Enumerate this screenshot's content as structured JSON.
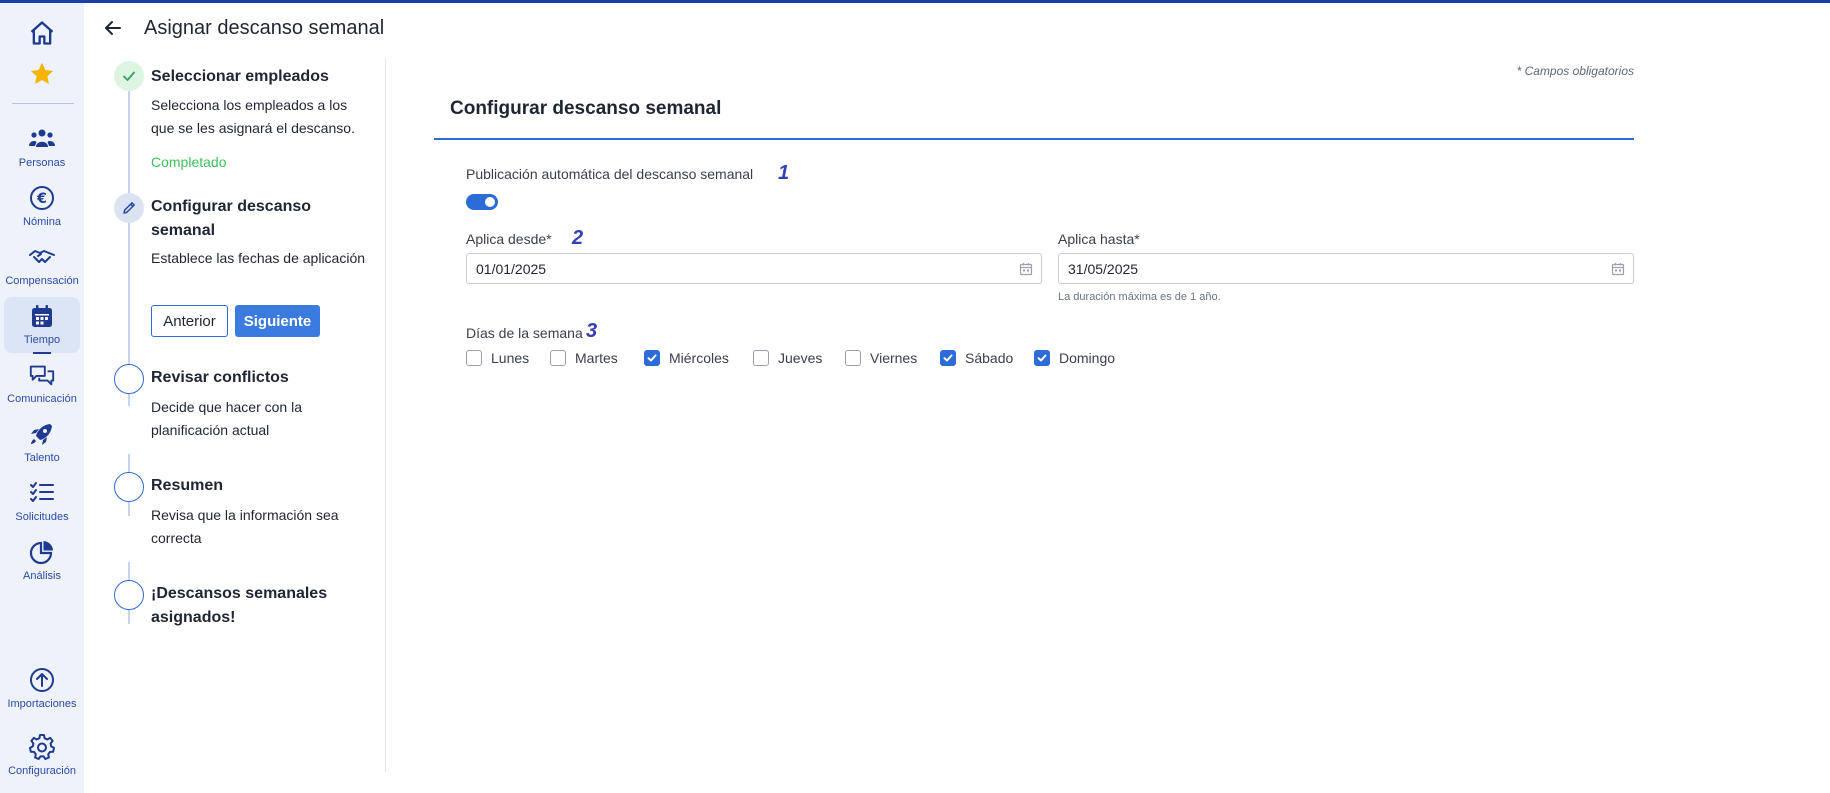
{
  "header": {
    "title": "Asignar descanso semanal"
  },
  "sidebar": {
    "top_icons": [
      {
        "name": "home-icon"
      },
      {
        "name": "star-icon"
      }
    ],
    "items": [
      {
        "label": "Personas",
        "icon": "people-icon"
      },
      {
        "label": "Nómina",
        "icon": "euro-icon"
      },
      {
        "label": "Compensación",
        "icon": "handshake-icon"
      },
      {
        "label": "Tiempo",
        "icon": "calendar-icon",
        "active": true
      },
      {
        "label": "Comunicación",
        "icon": "chat-bubbles-icon"
      },
      {
        "label": "Talento",
        "icon": "rocket-icon"
      },
      {
        "label": "Solicitudes",
        "icon": "checklist-icon"
      },
      {
        "label": "Análisis",
        "icon": "pie-chart-icon"
      }
    ],
    "bottom_items": [
      {
        "label": "Importaciones",
        "icon": "upload-circle-icon"
      },
      {
        "label": "Configuración",
        "icon": "gear-icon"
      }
    ]
  },
  "stepper": {
    "steps": [
      {
        "title": "Seleccionar empleados",
        "description": "Selecciona los empleados a los que se les asignará el descanso.",
        "status": "Completado",
        "state": "done"
      },
      {
        "title": "Configurar descanso semanal",
        "description": "Establece las fechas de aplicación",
        "state": "current"
      },
      {
        "title": "Revisar conflictos",
        "description": "Decide que hacer con la planificación actual",
        "state": "pending"
      },
      {
        "title": "Resumen",
        "description": "Revisa que la información sea correcta",
        "state": "pending"
      },
      {
        "title": "¡Descansos semanales asignados!",
        "description": "",
        "state": "pending"
      }
    ],
    "prev_label": "Anterior",
    "next_label": "Siguiente"
  },
  "form": {
    "required_note": "* Campos obligatorios",
    "section_title": "Configurar descanso semanal",
    "auto_publish": {
      "label": "Publicación automática del descanso semanal",
      "marker": "1",
      "enabled": true
    },
    "from": {
      "label": "Aplica desde*",
      "marker": "2",
      "value": "01/01/2025"
    },
    "to": {
      "label": "Aplica hasta*",
      "value": "31/05/2025",
      "hint": "La duración máxima es de 1 año."
    },
    "days": {
      "label": "Días de la semana",
      "marker": "3",
      "options": [
        {
          "label": "Lunes",
          "checked": false
        },
        {
          "label": "Martes",
          "checked": false
        },
        {
          "label": "Miércoles",
          "checked": true
        },
        {
          "label": "Jueves",
          "checked": false
        },
        {
          "label": "Viernes",
          "checked": false
        },
        {
          "label": "Sábado",
          "checked": true
        },
        {
          "label": "Domingo",
          "checked": true
        }
      ]
    }
  },
  "colors": {
    "accent": "#2d6cd6",
    "sidebar_bg": "#edf2fb",
    "success": "#3dc25e",
    "marker": "#3240b3"
  }
}
